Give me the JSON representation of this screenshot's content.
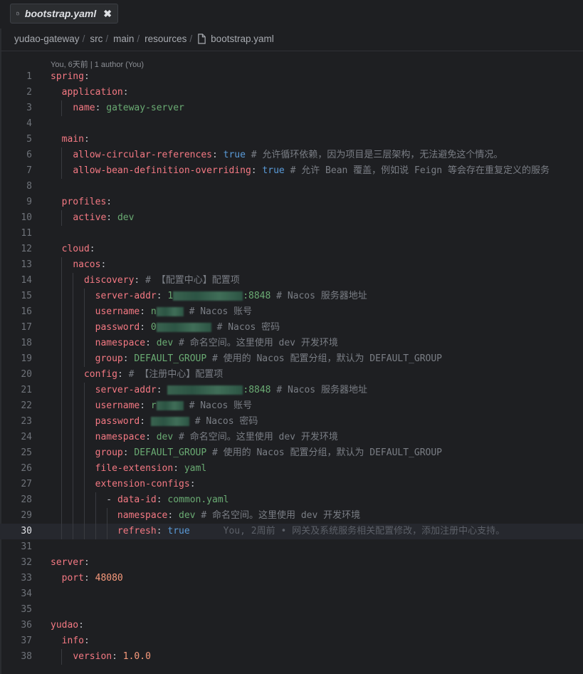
{
  "tab": {
    "title": "bootstrap.yaml",
    "close": "✖"
  },
  "breadcrumb": [
    "yudao-gateway",
    "src",
    "main",
    "resources",
    "bootstrap.yaml"
  ],
  "blame_lens": "You, 6天前 | 1 author (You)",
  "current_line": 30,
  "lines": [
    {
      "n": "1"
    },
    {
      "n": "2"
    },
    {
      "n": "3"
    },
    {
      "n": "4"
    },
    {
      "n": "5"
    },
    {
      "n": "6"
    },
    {
      "n": "7"
    },
    {
      "n": "8"
    },
    {
      "n": "9"
    },
    {
      "n": "10"
    },
    {
      "n": "11"
    },
    {
      "n": "12"
    },
    {
      "n": "13"
    },
    {
      "n": "14"
    },
    {
      "n": "15"
    },
    {
      "n": "16"
    },
    {
      "n": "17"
    },
    {
      "n": "18"
    },
    {
      "n": "19"
    },
    {
      "n": "20"
    },
    {
      "n": "21"
    },
    {
      "n": "22"
    },
    {
      "n": "23"
    },
    {
      "n": "24"
    },
    {
      "n": "25"
    },
    {
      "n": "26"
    },
    {
      "n": "27"
    },
    {
      "n": "28"
    },
    {
      "n": "29"
    },
    {
      "n": "30"
    },
    {
      "n": "31"
    },
    {
      "n": "32"
    },
    {
      "n": "33"
    },
    {
      "n": "34"
    },
    {
      "n": "35"
    },
    {
      "n": "36"
    },
    {
      "n": "37"
    },
    {
      "n": "38"
    }
  ],
  "code": {
    "spring": "spring",
    "application": "application",
    "name_key": "name",
    "name_val": "gateway-server",
    "main": "main",
    "acr_key": "allow-circular-references",
    "acr_val": "true",
    "acr_comment": "# 允许循环依赖，因为项目是三层架构，无法避免这个情况。",
    "abdo_key": "allow-bean-definition-overriding",
    "abdo_val": "true",
    "abdo_comment": "# 允许 Bean 覆盖，例如说 Feign 等会存在重复定义的服务",
    "profiles": "profiles",
    "active_key": "active",
    "active_val": "dev",
    "cloud": "cloud",
    "nacos": "nacos",
    "discovery": "discovery",
    "discovery_comment": "# 【配置中心】配置项",
    "server_addr_key": "server-addr",
    "server_addr_prefix": "1",
    "server_addr_port": ":8848",
    "server_addr_comment": "# Nacos 服务器地址",
    "username_key": "username",
    "username_prefix": "n",
    "username_comment": "# Nacos 账号",
    "password_key": "password",
    "password_prefix": "0",
    "password_comment": "# Nacos 密码",
    "namespace_key": "namespace",
    "namespace_val": "dev",
    "namespace_comment": "# 命名空间。这里使用 dev 开发环境",
    "group_key": "group",
    "group_val": "DEFAULT_GROUP",
    "group_comment": "# 使用的 Nacos 配置分组，默认为 DEFAULT_GROUP",
    "config": "config",
    "config_comment": "# 【注册中心】配置项",
    "config_server_prefix": "",
    "config_username_prefix": "r",
    "config_password_prefix": "",
    "file_ext_key": "file-extension",
    "file_ext_val": "yaml",
    "ext_configs": "extension-configs",
    "dash": "- ",
    "data_id_key": "data-id",
    "data_id_val": "common.yaml",
    "refresh_key": "refresh",
    "refresh_val": "true",
    "refresh_blame": "You, 2周前 • 网关及系统服务相关配置修改，添加注册中心支持。",
    "server": "server",
    "port_key": "port",
    "port_val": "48080",
    "yudao": "yudao",
    "info": "info",
    "version_key": "version",
    "version_val": "1.0.0"
  }
}
